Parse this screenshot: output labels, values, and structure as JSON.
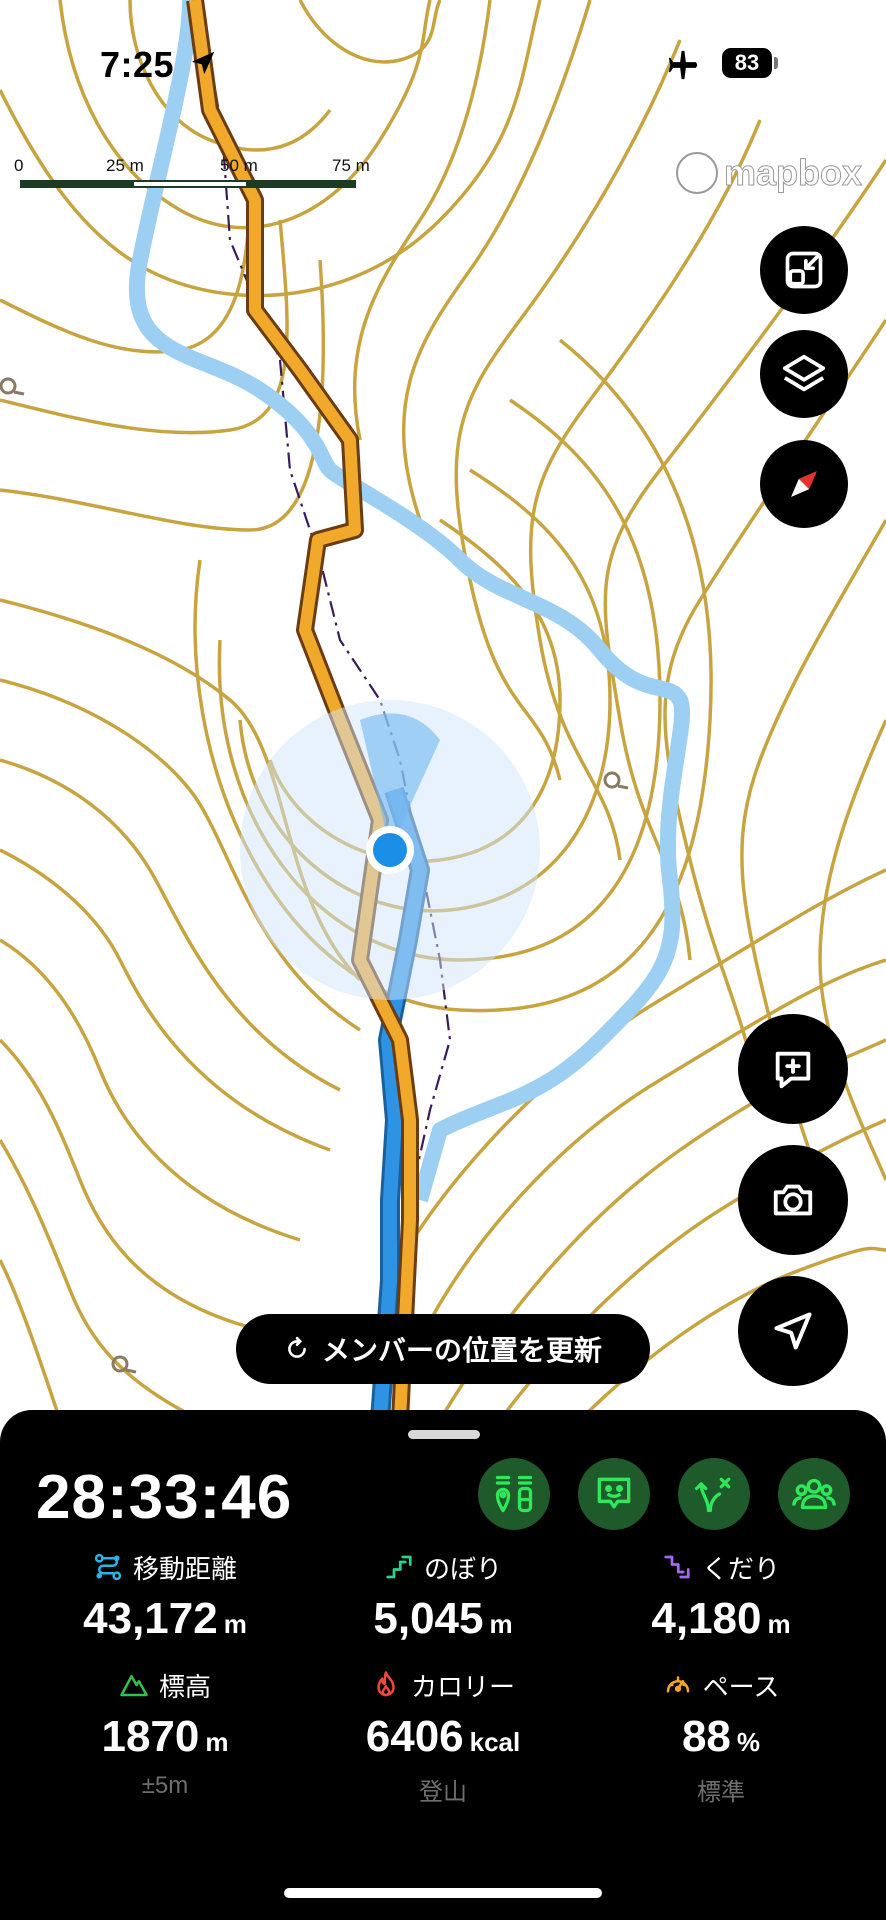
{
  "status_bar": {
    "time": "7:25",
    "battery": "83"
  },
  "scale_bar": {
    "labels": [
      "0",
      "25 m",
      "50 m",
      "75 m"
    ]
  },
  "map": {
    "attribution": "mapbox"
  },
  "update_button": {
    "label": "メンバーの位置を更新"
  },
  "panel": {
    "elapsed": "28:33:46",
    "stats": [
      {
        "label": "移動距離",
        "value": "43,172",
        "unit": "m",
        "icon": "route-icon",
        "color": "#27b6e8"
      },
      {
        "label": "のぼり",
        "value": "5,045",
        "unit": "m",
        "icon": "ascent-icon",
        "color": "#2bd48a"
      },
      {
        "label": "くだり",
        "value": "4,180",
        "unit": "m",
        "icon": "descent-icon",
        "color": "#a46bf2"
      },
      {
        "label": "標高",
        "value": "1870",
        "unit": "m",
        "sub": "±5m",
        "icon": "mountain-icon",
        "color": "#32c24a"
      },
      {
        "label": "カロリー",
        "value": "6406",
        "unit": "kcal",
        "sub": "登山",
        "icon": "flame-icon",
        "color": "#f2483a"
      },
      {
        "label": "ペース",
        "value": "88",
        "unit": "%",
        "sub": "標準",
        "icon": "speedometer-icon",
        "color": "#f5a623"
      }
    ]
  },
  "colors": {
    "contour": "#c8a441",
    "planned_route": "#f0a92b",
    "recorded_track": "#2f93e3",
    "other_track": "#9ccff2",
    "accent_green": "#2ee85a"
  }
}
